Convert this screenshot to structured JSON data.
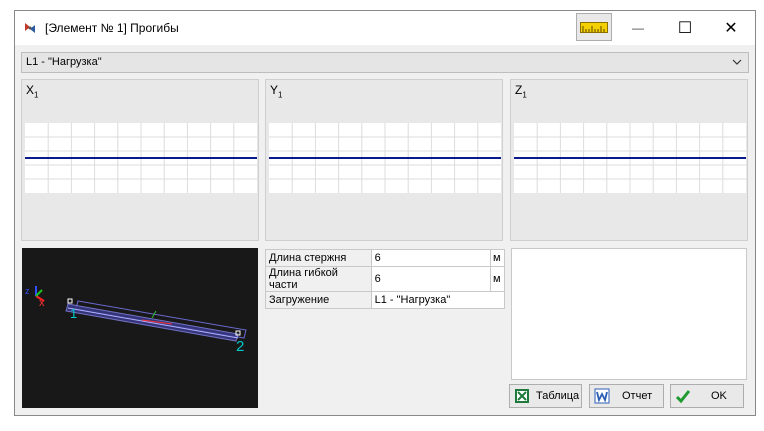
{
  "window": {
    "title": "[Элемент № 1] Прогибы",
    "minimize_glyph": "—",
    "maximize_glyph": "☐",
    "close_glyph": "✕"
  },
  "load_selector": {
    "value": "L1 - \"Нагрузка\""
  },
  "plots": [
    {
      "axis": "X",
      "sub": "1"
    },
    {
      "axis": "Y",
      "sub": "1"
    },
    {
      "axis": "Z",
      "sub": "1"
    }
  ],
  "view3d": {
    "node_start": "1",
    "node_end": "2",
    "axis_x": "x",
    "axis_z": "z"
  },
  "properties": [
    {
      "label": "Длина стержня",
      "value": "6",
      "unit": "м"
    },
    {
      "label": "Длина гибкой части",
      "value": "6",
      "unit": "м"
    },
    {
      "label": "Загружение",
      "value": "L1 - \"Нагрузка\"",
      "unit": ""
    }
  ],
  "buttons": {
    "table": "Таблица",
    "report": "Отчет",
    "ok": "OK"
  },
  "colors": {
    "plot_line": "#0a1a8c",
    "grid": "#dcdcdc",
    "node_label": "#00c8c8"
  },
  "icons": {
    "ruler": "ruler-icon",
    "excel": "excel-icon",
    "word": "word-icon",
    "check": "check-icon"
  }
}
